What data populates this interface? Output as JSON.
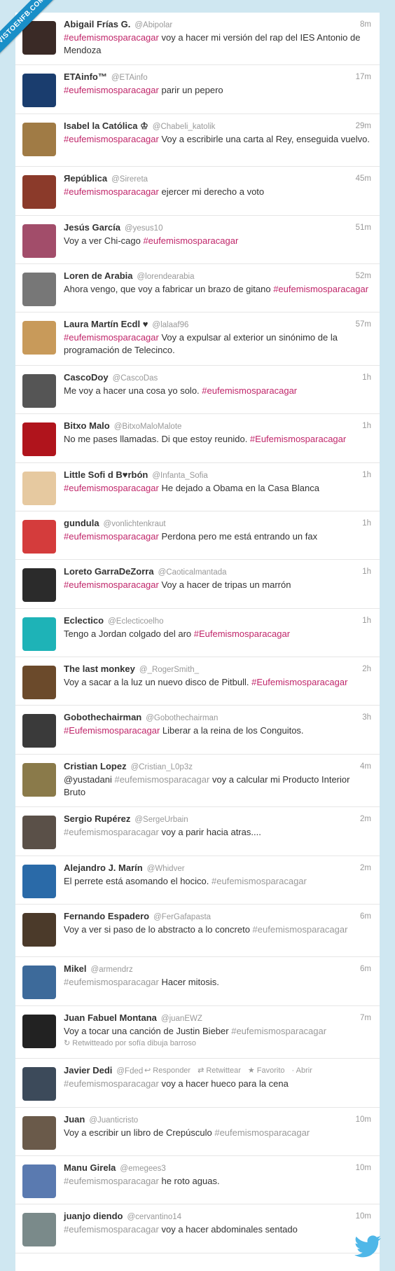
{
  "watermark": "VISTOENFB.COM",
  "tweets": [
    {
      "name": "Abigail Frías G.",
      "handle": "@Abipolar",
      "time": "8m",
      "pre": "",
      "tag": "#eufemismosparacagar",
      "post": " voy a hacer mi versión del rap del IES Antonio de Mendoza",
      "avatar": "#3a2a26",
      "muted": false
    },
    {
      "name": "ETAinfo™",
      "handle": "@ETAinfo",
      "time": "17m",
      "pre": "",
      "tag": "#eufemismosparacagar",
      "post": " parir un pepero",
      "avatar": "#1a3d6e",
      "muted": false
    },
    {
      "name": "Isabel la Católica ♔",
      "handle": "@Chabeli_katolik",
      "time": "29m",
      "pre": "",
      "tag": "#eufemismosparacagar",
      "post": " Voy a escribirle una carta al Rey, enseguida vuelvo.",
      "avatar": "#a07b45",
      "muted": false
    },
    {
      "name": "Яepública",
      "handle": "@Sirereta",
      "time": "45m",
      "pre": "",
      "tag": "#eufemismosparacagar",
      "post": " ejercer mi derecho a voto",
      "avatar": "#8b3a2a",
      "muted": false
    },
    {
      "name": "Jesús García",
      "handle": "@yesus10",
      "time": "51m",
      "pre": "Voy a ver Chi-cago ",
      "tag": "#eufemismosparacagar",
      "post": "",
      "avatar": "#a24d6a",
      "muted": false
    },
    {
      "name": "Loren de Arabia",
      "handle": "@lorendearabia",
      "time": "52m",
      "pre": "Ahora vengo, que voy a fabricar un brazo de gitano ",
      "tag": "#eufemismosparacagar",
      "post": "",
      "avatar": "#777777",
      "muted": false
    },
    {
      "name": "Laura Martín Ecdl ♥",
      "handle": "@lalaaf96",
      "time": "57m",
      "pre": "",
      "tag": "#eufemismosparacagar",
      "post": " Voy a expulsar al exterior un sinónimo de la programación de Telecinco.",
      "avatar": "#c89a5a",
      "muted": false
    },
    {
      "name": "CascoDoy",
      "handle": "@CascoDas",
      "time": "1h",
      "pre": "Me voy a hacer una cosa yo solo. ",
      "tag": "#eufemismosparacagar",
      "post": "",
      "avatar": "#555555",
      "muted": false
    },
    {
      "name": "Bitxo Malo",
      "handle": "@BitxoMaloMalote",
      "time": "1h",
      "pre": "No me pases llamadas. Di que estoy reunido. ",
      "tag": "#Eufemismosparacagar",
      "post": "",
      "avatar": "#b0141c",
      "muted": false
    },
    {
      "name": "Little Sofi d B♥rbón",
      "handle": "@Infanta_Sofia",
      "time": "1h",
      "pre": "",
      "tag": "#eufemismosparacagar",
      "post": " He dejado a Obama en la Casa Blanca",
      "avatar": "#e6c9a0",
      "muted": false
    },
    {
      "name": "gundula",
      "handle": "@vonlichtenkraut",
      "time": "1h",
      "pre": "",
      "tag": "#eufemismosparacagar",
      "post": " Perdona pero me está entrando un fax",
      "avatar": "#d43c3c",
      "muted": false
    },
    {
      "name": "Loreto GarraDeZorra",
      "handle": "@Caoticalmantada",
      "time": "1h",
      "pre": "",
      "tag": "#eufemismosparacagar",
      "post": " Voy a hacer de tripas un marrón",
      "avatar": "#2b2b2b",
      "muted": false
    },
    {
      "name": "Eclectico",
      "handle": "@Eclecticoelho",
      "time": "1h",
      "pre": "Tengo a Jordan colgado del aro ",
      "tag": "#Eufemismosparacagar",
      "post": "",
      "avatar": "#1eb3b7",
      "muted": false
    },
    {
      "name": "The last monkey",
      "handle": "@_RogerSmith_",
      "time": "2h",
      "pre": "Voy a sacar a la luz un nuevo disco de Pitbull. ",
      "tag": "#Eufemismosparacagar",
      "post": "",
      "avatar": "#6b4a2b",
      "muted": false
    },
    {
      "name": "Gobothechairman",
      "handle": "@Gobothechairman",
      "time": "3h",
      "pre": "",
      "tag": "#Eufemismosparacagar",
      "post": " Liberar a la reina de los Conguitos.",
      "avatar": "#3a3a3a",
      "muted": false
    },
    {
      "name": "Cristian Lopez",
      "handle": "@Cristian_L0p3z",
      "time": "4m",
      "pre": "@yustadani ",
      "tag": "#eufemismosparacagar",
      "post": " voy a calcular mi Producto Interior Bruto",
      "avatar": "#8a7a4a",
      "muted": true
    },
    {
      "name": "Sergio Rupérez",
      "handle": "@SergeUrbain",
      "time": "2m",
      "pre": "",
      "tag": "#eufemismosparacagar",
      "post": " voy a parir hacia atras....",
      "avatar": "#5a5048",
      "muted": true
    },
    {
      "name": "Alejandro J. Marín",
      "handle": "@Whidver",
      "time": "2m",
      "pre": "El perrete está asomando el hocico. ",
      "tag": "#eufemismosparacagar",
      "post": "",
      "avatar": "#2a6aa8",
      "muted": true
    },
    {
      "name": "Fernando Espadero",
      "handle": "@FerGafapasta",
      "time": "6m",
      "pre": "Voy a ver si paso de lo abstracto a lo concreto ",
      "tag": "#eufemismosparacagar",
      "post": "",
      "avatar": "#4b3a2a",
      "muted": true
    },
    {
      "name": "Mikel",
      "handle": "@armendrz",
      "time": "6m",
      "pre": "",
      "tag": "#eufemismosparacagar",
      "post": " Hacer mitosis.",
      "avatar": "#3d6a9a",
      "muted": true
    },
    {
      "name": "Juan Fabuel Montana",
      "handle": "@juanEWZ",
      "time": "7m",
      "pre": "Voy a tocar una canción de Justin Bieber ",
      "tag": "#eufemismosparacagar",
      "post": "",
      "avatar": "#222222",
      "muted": true,
      "retweet": "↻ Retwitteado por sofía dibuja barroso"
    },
    {
      "name": "Javier Dedi",
      "handle": "@Fded",
      "time": "",
      "pre": "",
      "tag": "#eufemismosparacagar",
      "post": " voy a hacer hueco para la cena",
      "avatar": "#3c4a5a",
      "muted": true,
      "actions": [
        "↩ Responder",
        "⇄ Retwittear",
        "★ Favorito",
        "· Abrir"
      ]
    },
    {
      "name": "Juan",
      "handle": "@Juanticristo",
      "time": "10m",
      "pre": "Voy a escribir un libro de Crepúsculo ",
      "tag": "#eufemismosparacagar",
      "post": "",
      "avatar": "#6a5a4a",
      "muted": true
    },
    {
      "name": "Manu Girela",
      "handle": "@emegees3",
      "time": "10m",
      "pre": "",
      "tag": "#eufemismosparacagar",
      "post": " he roto aguas.",
      "avatar": "#5a7ab0",
      "muted": true
    },
    {
      "name": "juanjo diendo",
      "handle": "@cervantino14",
      "time": "10m",
      "pre": "",
      "tag": "#eufemismosparacagar",
      "post": " voy a hacer abdominales sentado",
      "avatar": "#7a8a8a",
      "muted": true
    }
  ]
}
